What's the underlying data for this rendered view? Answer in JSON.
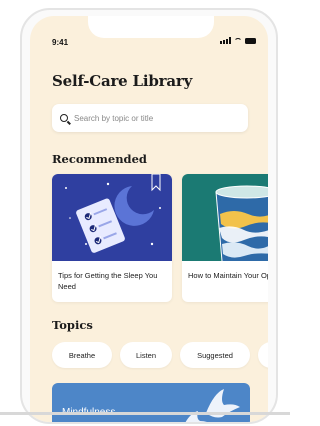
{
  "status_bar": {
    "time": "9:41"
  },
  "page": {
    "title": "Self-Care Library"
  },
  "search": {
    "placeholder": "Search by topic or title"
  },
  "recommended": {
    "heading": "Recommended",
    "cards": [
      {
        "title": "Tips for Getting the Sleep You Need"
      },
      {
        "title": "How to Maintain Your Optimism"
      }
    ]
  },
  "topics": {
    "heading": "Topics",
    "chips": [
      "Breathe",
      "Listen",
      "Suggested",
      ""
    ]
  },
  "featured": {
    "label": "Mindfulness"
  },
  "colors": {
    "background": "#fbf0dc",
    "sleep_card": "#2f3fa0",
    "optimism_card": "#1b7a73",
    "banner": "#4d86c8"
  },
  "icons": [
    "search-icon",
    "signal-icon",
    "wifi-icon",
    "battery-icon"
  ]
}
